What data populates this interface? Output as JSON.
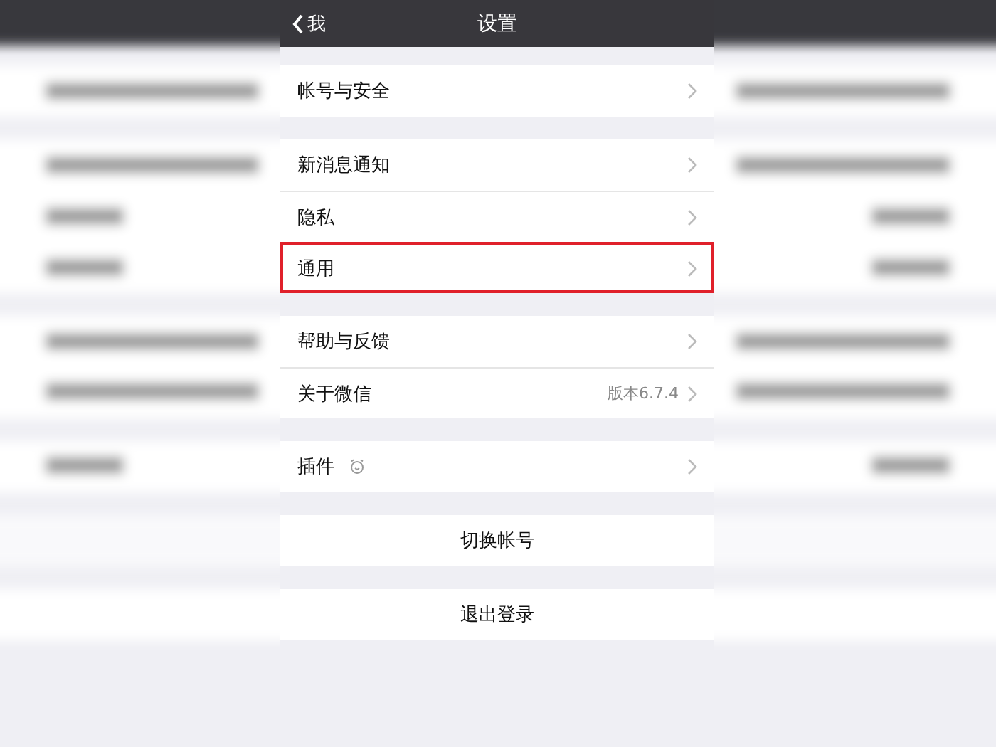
{
  "nav": {
    "back": "我",
    "title": "设置"
  },
  "groups": [
    {
      "items": [
        {
          "kind": "link",
          "label": "帐号与安全",
          "highlighted": false
        }
      ]
    },
    {
      "items": [
        {
          "kind": "link",
          "label": "新消息通知",
          "highlighted": false
        },
        {
          "kind": "link",
          "label": "隐私",
          "highlighted": false
        },
        {
          "kind": "link",
          "label": "通用",
          "highlighted": true
        }
      ]
    },
    {
      "items": [
        {
          "kind": "link",
          "label": "帮助与反馈",
          "highlighted": false
        },
        {
          "kind": "link",
          "label": "关于微信",
          "value": "版本6.7.4",
          "highlighted": false
        }
      ]
    },
    {
      "items": [
        {
          "kind": "link_icon",
          "label": "插件",
          "highlighted": false
        }
      ]
    },
    {
      "items": [
        {
          "kind": "action",
          "label": "切换帐号",
          "highlighted": false
        }
      ]
    },
    {
      "items": [
        {
          "kind": "action",
          "label": "退出登录",
          "highlighted": false
        }
      ]
    }
  ]
}
